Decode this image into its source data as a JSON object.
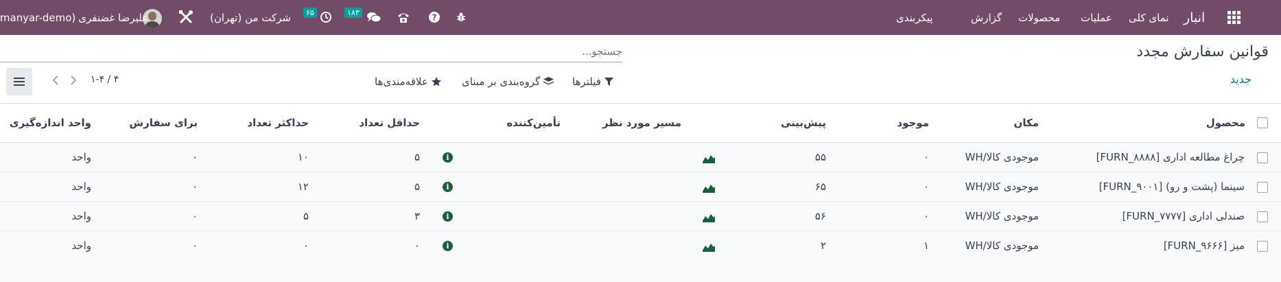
{
  "navbar": {
    "app_name": "انبار",
    "menu": [
      "نمای کلی",
      "عملیات",
      "محصولات",
      "گزارش",
      "پیکربندی"
    ],
    "activity_count": "۶۵",
    "message_count": "۱۸۳",
    "company": "شرکت من (تهران)",
    "user_name": "علیرضا غضنفری",
    "db_name": "(manyar-demo)",
    "accent_color": "#714b67",
    "badge_color": "#00a09d"
  },
  "control_panel": {
    "title": "قوانین سفارش مجدد",
    "new_button": "جدید",
    "search_placeholder": "جستجو...",
    "filters_label": "فیلترها",
    "group_by_label": "گروه‌بندی بر مبنای",
    "favorites_label": "علاقه‌مندی‌ها",
    "pager": "۱-۴ / ۴"
  },
  "table": {
    "columns": [
      "محصول",
      "مکان",
      "موجود",
      "پیش‌بینی",
      "مسیر مورد نظر",
      "تأمین‌کننده",
      "حداقل تعداد",
      "حداکثر تعداد",
      "برای سفارش",
      "واحد اندازه‌گیری"
    ],
    "rows": [
      {
        "product": "[FURN_۸۸۸۸] چراغ مطالعه اداری",
        "location": "WH/موجودی کالا",
        "on_hand": "۰",
        "forecast": "۵۵",
        "route": "",
        "vendor": "",
        "min": "۵",
        "max": "۱۰",
        "to_order": "۰",
        "uom": "واحد"
      },
      {
        "product": "[FURN_۹۰۰۱] سینما (پشت و رو)",
        "location": "WH/موجودی کالا",
        "on_hand": "۰",
        "forecast": "۶۵",
        "route": "",
        "vendor": "",
        "min": "۵",
        "max": "۱۲",
        "to_order": "۰",
        "uom": "واحد"
      },
      {
        "product": "[FURN_۷۷۷۷] صندلی اداری",
        "location": "WH/موجودی کالا",
        "on_hand": "۰",
        "forecast": "۵۶",
        "route": "",
        "vendor": "",
        "min": "۳",
        "max": "۵",
        "to_order": "۰",
        "uom": "واحد"
      },
      {
        "product": "[FURN_۹۶۶۶] میز",
        "location": "WH/موجودی کالا",
        "on_hand": "۱",
        "forecast": "۲",
        "route": "",
        "vendor": "",
        "min": "۰",
        "max": "۰",
        "to_order": "۰",
        "uom": "واحد"
      }
    ]
  }
}
